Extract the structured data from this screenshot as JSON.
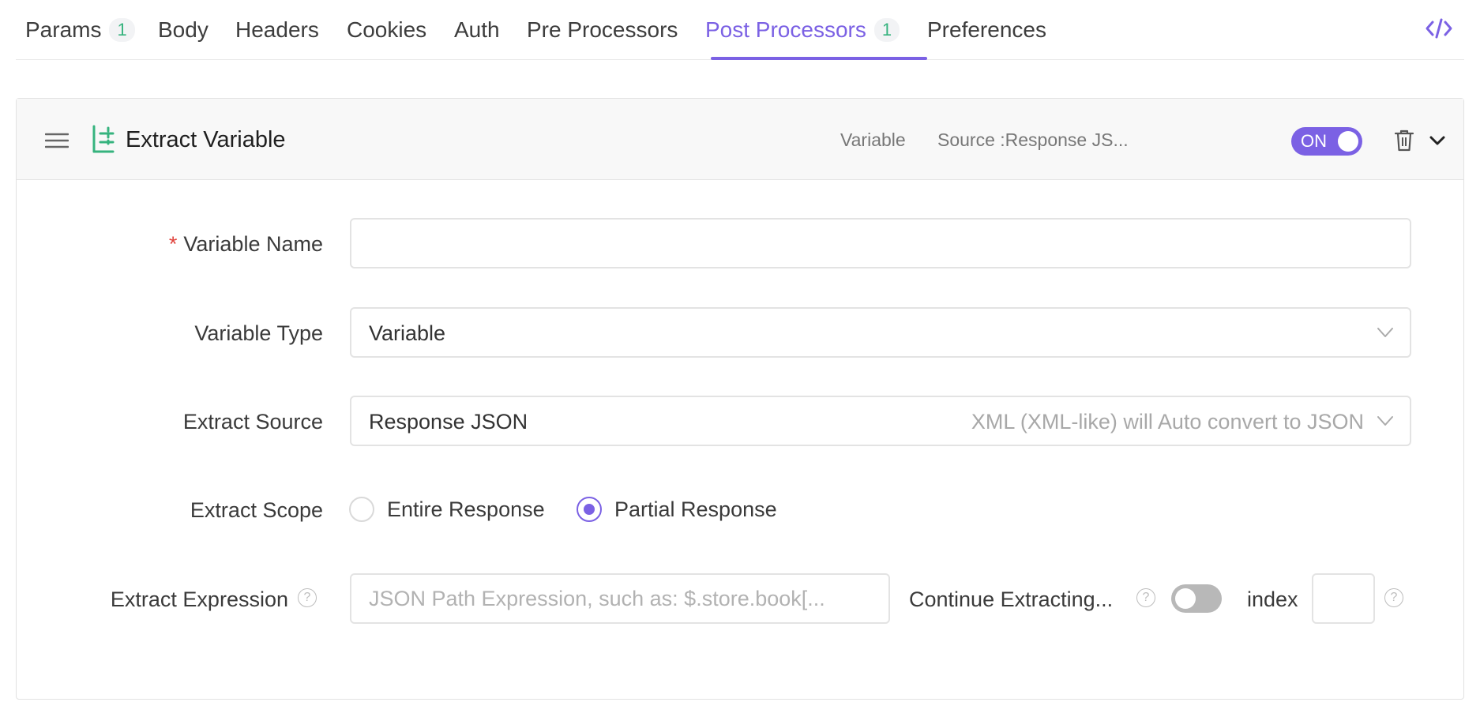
{
  "tabs": [
    {
      "label": "Params",
      "badge": "1"
    },
    {
      "label": "Body"
    },
    {
      "label": "Headers"
    },
    {
      "label": "Cookies"
    },
    {
      "label": "Auth"
    },
    {
      "label": "Pre Processors"
    },
    {
      "label": "Post Processors",
      "badge": "1",
      "active": true
    },
    {
      "label": "Preferences"
    }
  ],
  "processor": {
    "title": "Extract Variable",
    "meta_type": "Variable",
    "meta_source": "Source :Response JS...",
    "toggle_label": "ON",
    "enabled": true
  },
  "form": {
    "variable_name": {
      "required_mark": "*",
      "label": "Variable Name",
      "value": ""
    },
    "variable_type": {
      "label": "Variable Type",
      "value": "Variable"
    },
    "extract_source": {
      "label": "Extract Source",
      "value": "Response JSON",
      "hint": "XML (XML-like) will Auto convert to JSON"
    },
    "extract_scope": {
      "label": "Extract Scope",
      "options": [
        "Entire Response",
        "Partial Response"
      ],
      "selected": "Partial Response"
    },
    "extract_expression": {
      "label": "Extract Expression",
      "placeholder": "JSON Path Expression, such as: $.store.book[...",
      "continue_label": "Continue Extracting...",
      "continue_enabled": false,
      "index_label": "index",
      "index_value": ""
    }
  },
  "icons": {
    "code": "code-icon",
    "drag": "hamburger-icon",
    "extract": "extract-variable-icon",
    "delete": "trash-icon",
    "collapse": "chevron-down-icon",
    "dropdown": "chevron-down-icon",
    "help": "question-circle-icon"
  },
  "colors": {
    "accent": "#7b61e4",
    "badge": "#36b37e",
    "extract_icon": "#36b37e",
    "required": "#e0443e"
  }
}
